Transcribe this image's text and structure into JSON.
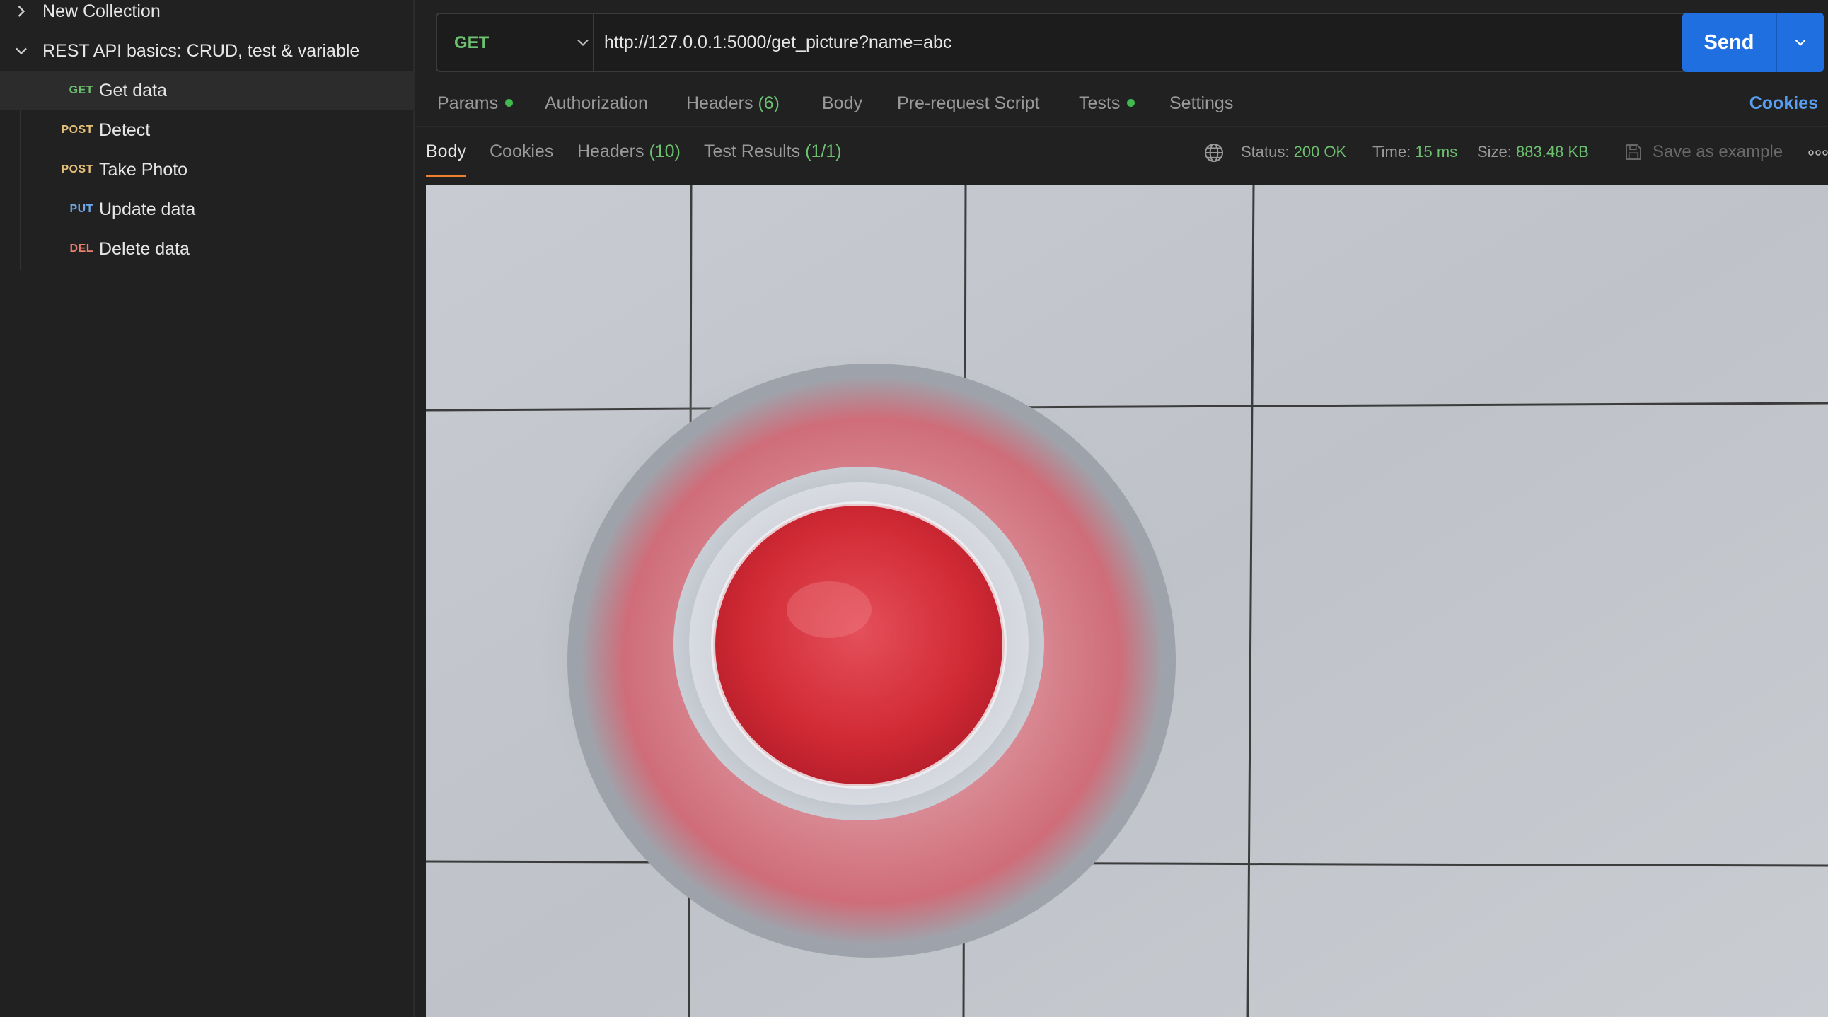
{
  "sidebar": {
    "collections": [
      {
        "label": "New Collection",
        "expanded": false,
        "icon": "chevron-right-icon"
      },
      {
        "label": "REST API basics: CRUD, test & variable",
        "expanded": true,
        "icon": "chevron-down-icon"
      }
    ],
    "requests": [
      {
        "method": "GET",
        "label": "Get data",
        "active": true,
        "color": "#6cc070"
      },
      {
        "method": "POST",
        "label": "Detect",
        "active": false,
        "color": "#e5c07b"
      },
      {
        "method": "POST",
        "label": "Take Photo",
        "active": false,
        "color": "#e5c07b"
      },
      {
        "method": "PUT",
        "label": "Update data",
        "active": false,
        "color": "#6ea8e8"
      },
      {
        "method": "DEL",
        "label": "Delete data",
        "active": false,
        "color": "#e8806f"
      }
    ]
  },
  "request": {
    "method": "GET",
    "url": "http://127.0.0.1:5000/get_picture?name=abc",
    "send_label": "Send"
  },
  "request_tabs": {
    "params": "Params",
    "authorization": "Authorization",
    "headers": "Headers",
    "headers_count": "(6)",
    "body": "Body",
    "pre_request": "Pre-request Script",
    "tests": "Tests",
    "settings": "Settings",
    "cookies": "Cookies"
  },
  "response": {
    "tabs": {
      "body": "Body",
      "cookies": "Cookies",
      "headers": "Headers",
      "headers_count": "(10)",
      "test_results": "Test Results",
      "test_results_count": "(1/1)"
    },
    "status_label": "Status:",
    "status_value": "200 OK",
    "time_label": "Time:",
    "time_value": "15 ms",
    "size_label": "Size:",
    "size_value": "883.48 KB",
    "save_example": "Save as example"
  },
  "colors": {
    "accent": "#1f6fe0",
    "success": "#6cc070",
    "active_tab_underline": "#f07f2f",
    "link": "#5a9ef0"
  }
}
